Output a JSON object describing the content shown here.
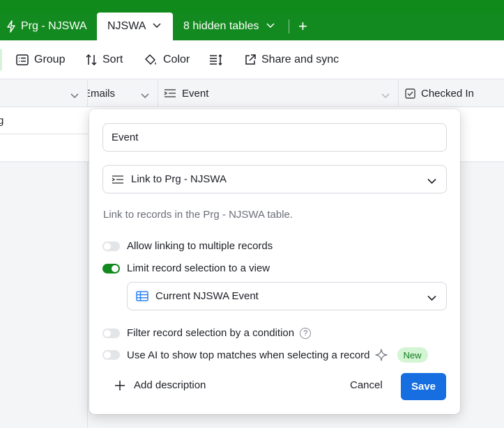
{
  "tabs": {
    "tab1_label": "Prg - NJSWA",
    "tab2_label": "NJSWA",
    "hidden_label": "8 hidden tables",
    "add_symbol": "+"
  },
  "toolbar": {
    "group_label": "Group",
    "sort_label": "Sort",
    "color_label": "Color",
    "share_label": "Share and sync"
  },
  "grid": {
    "col_emails": "Emails",
    "col_event": "Event",
    "col_checked": "Checked In",
    "row1_text": "g"
  },
  "field_config": {
    "field_name": "Event",
    "field_type": "Link to Prg - NJSWA",
    "description": "Link to records in the Prg - NJSWA table.",
    "options": {
      "allow_multiple": "Allow linking to multiple records",
      "limit_view": "Limit record selection to a view",
      "filter_condition": "Filter record selection by a condition",
      "ai_matches": "Use AI to show top matches when selecting a record"
    },
    "selected_view": "Current NJSWA Event",
    "new_badge": "New",
    "help_symbol": "?",
    "add_description": "Add description",
    "cancel_label": "Cancel",
    "save_label": "Save"
  },
  "colors": {
    "brand_green": "#138a1f",
    "primary_blue": "#166ee1"
  }
}
